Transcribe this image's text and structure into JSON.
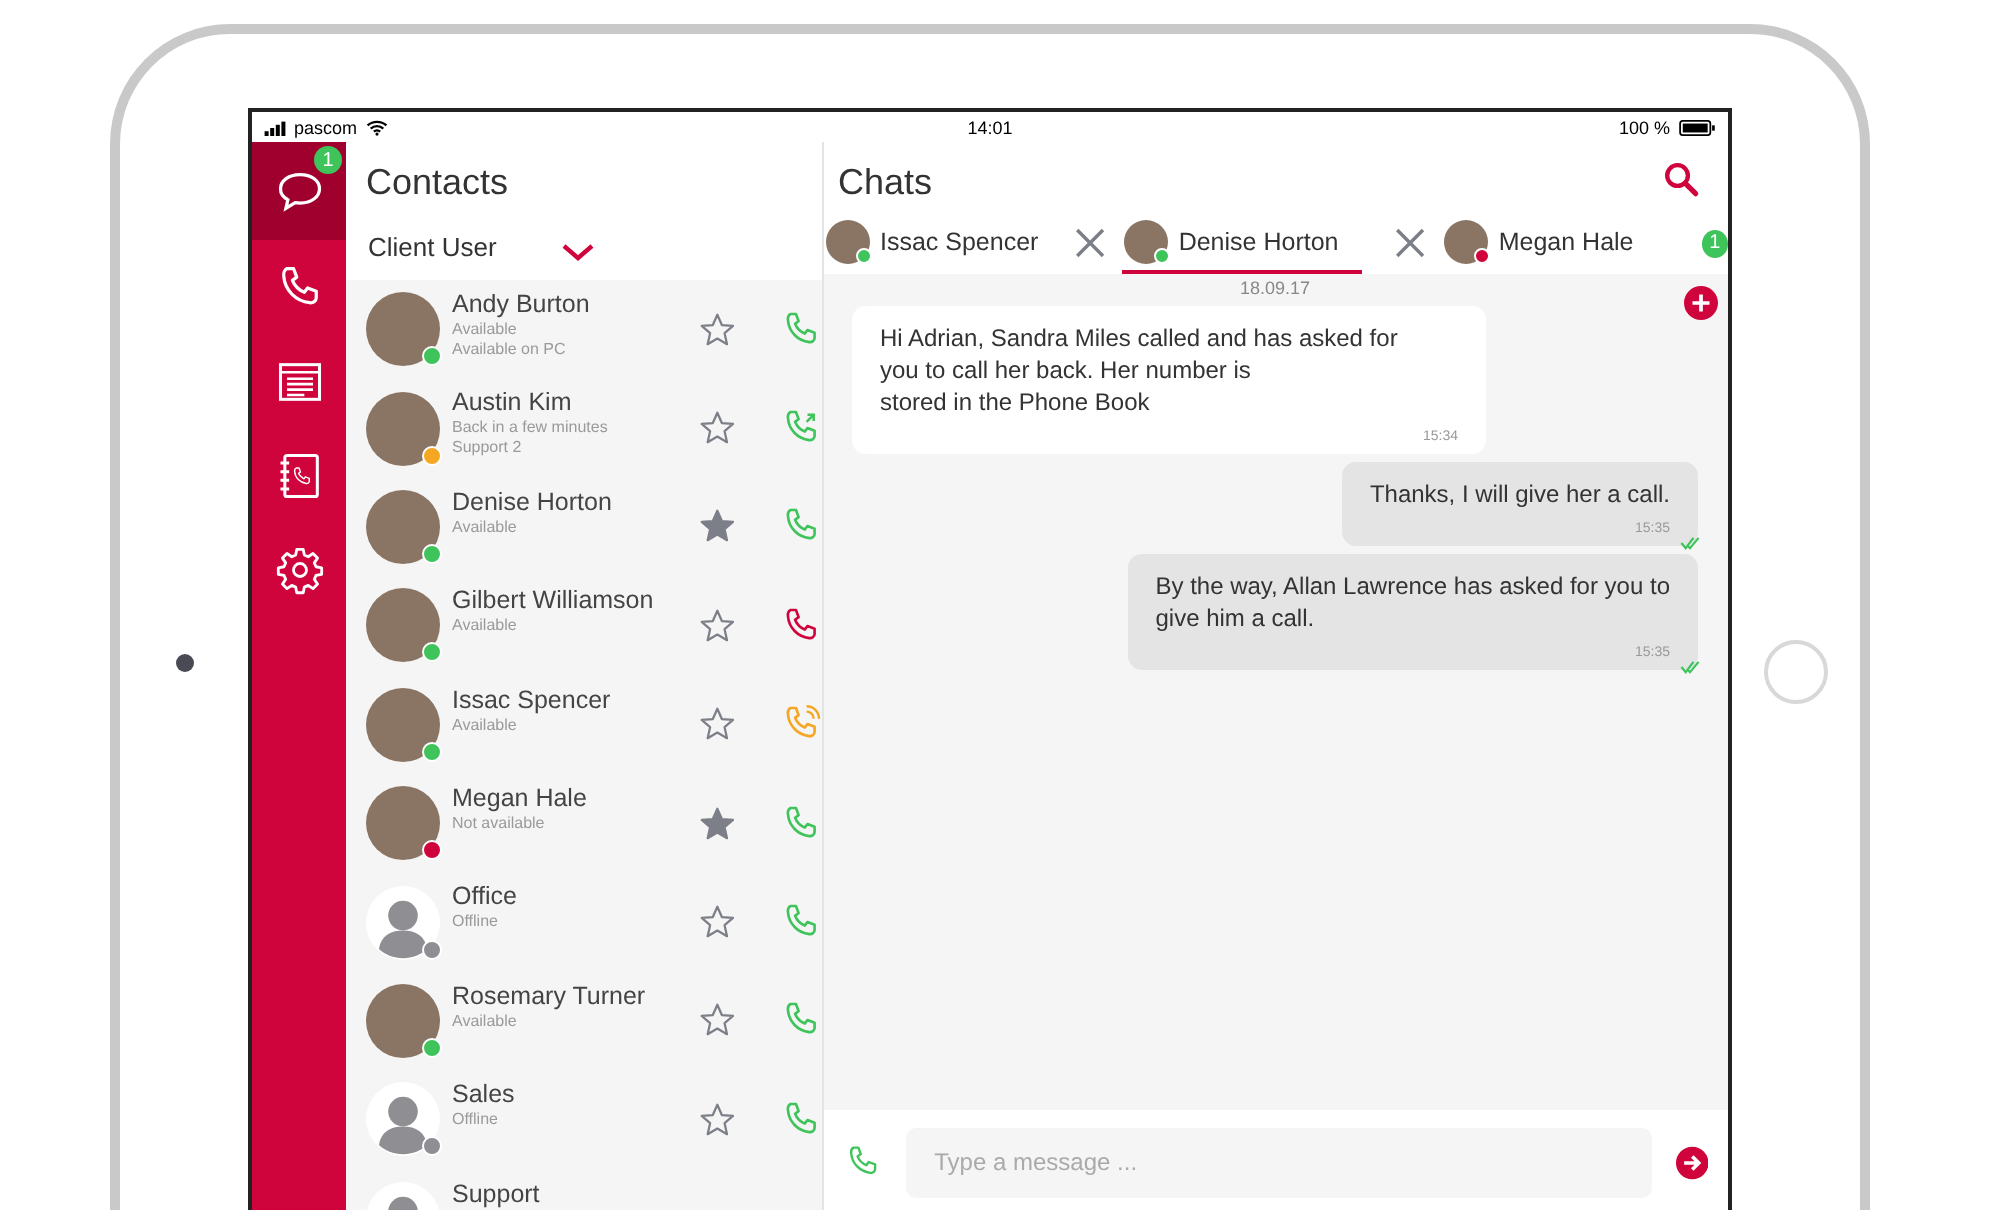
{
  "status_bar": {
    "carrier": "pascom",
    "time": "14:01",
    "battery": "100 %"
  },
  "rail": [
    {
      "kind": "chat",
      "selected": true,
      "badge": "1"
    },
    {
      "kind": "phone",
      "selected": false
    },
    {
      "kind": "notes",
      "selected": false
    },
    {
      "kind": "phonebook",
      "selected": false
    },
    {
      "kind": "settings",
      "selected": false
    }
  ],
  "contacts": {
    "title": "Contacts",
    "filter": "Client User",
    "items": [
      {
        "name": "Andy Burton",
        "status": "Available",
        "note": "Available on PC",
        "photo": true,
        "color": "#3ec45a",
        "favorite": false,
        "kind": "call"
      },
      {
        "name": "Austin Kim",
        "status": "Back in a few minutes",
        "note": "Support 2",
        "photo": true,
        "color": "#f5a623",
        "favorite": false,
        "kind": "callback"
      },
      {
        "name": "Denise Horton",
        "status": "Available",
        "photo": true,
        "color": "#3ec45a",
        "favorite": true,
        "kind": "call"
      },
      {
        "name": "Gilbert Williamson",
        "status": "Available",
        "photo": true,
        "color": "#3ec45a",
        "favorite": false,
        "kind": "busy"
      },
      {
        "name": "Issac Spencer",
        "status": "Available",
        "photo": true,
        "color": "#3ec45a",
        "favorite": false,
        "kind": "ringing"
      },
      {
        "name": "Megan Hale",
        "status": "Not available",
        "photo": true,
        "color": "#d0043c",
        "favorite": true,
        "kind": "call"
      },
      {
        "name": "Office",
        "status": "Offline",
        "photo": false,
        "color": "#8e8e93",
        "favorite": false,
        "kind": "call"
      },
      {
        "name": "Rosemary Turner",
        "status": "Available",
        "photo": true,
        "color": "#3ec45a",
        "favorite": false,
        "kind": "call"
      },
      {
        "name": "Sales",
        "status": "Offline",
        "photo": false,
        "color": "#8e8e93",
        "favorite": false,
        "kind": "call"
      },
      {
        "name": "Support",
        "photo": false
      }
    ]
  },
  "chats": {
    "title": "Chats",
    "tabs": [
      {
        "name": "Issac Spencer",
        "color": "#3ec45a",
        "selected": false,
        "closable": true
      },
      {
        "name": "Denise Horton",
        "color": "#3ec45a",
        "selected": true,
        "closable": true
      },
      {
        "name": "Megan Hale",
        "color": "#d0043c",
        "selected": false,
        "closable": false,
        "badge": "1"
      }
    ],
    "date": "18.09.17",
    "messages": [
      {
        "kind": "in",
        "text": "Hi Adrian, Sandra Miles called and has asked for\nyou to call her back. Her number is\nstored in the Phone Book",
        "time": "15:34"
      },
      {
        "kind": "out",
        "text": "Thanks, I will give her a call.",
        "time": "15:35",
        "read": true
      },
      {
        "kind": "out",
        "text": "By the way, Allan Lawrence has asked for you to\ngive him a call.",
        "time": "15:35",
        "read": true
      }
    ],
    "input": {
      "placeholder": "Type a message ..."
    }
  }
}
